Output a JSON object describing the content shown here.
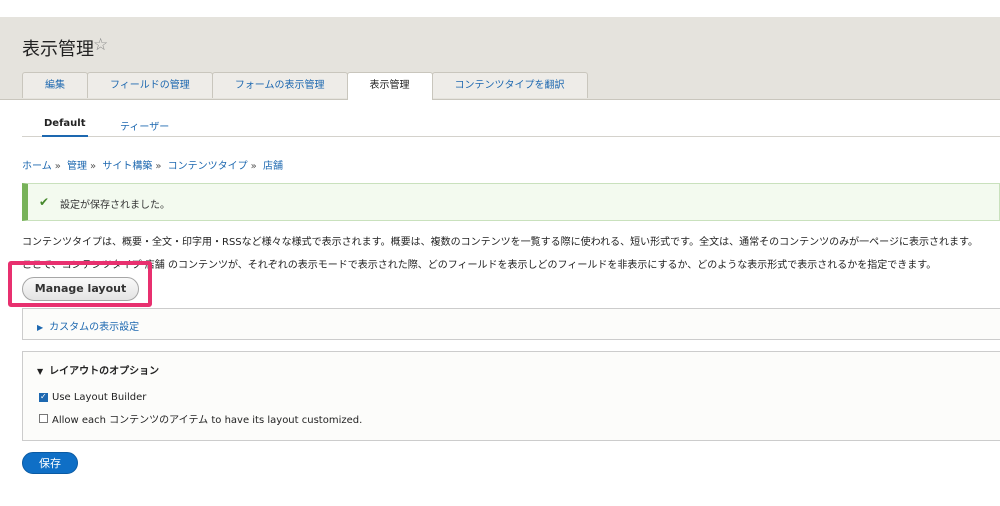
{
  "header": {
    "title": "表示管理",
    "star_icon": "☆"
  },
  "tabs": [
    {
      "label": "編集"
    },
    {
      "label": "フィールドの管理"
    },
    {
      "label": "フォームの表示管理"
    },
    {
      "label": "表示管理"
    },
    {
      "label": "コンテンツタイプを翻訳"
    }
  ],
  "subtabs": [
    {
      "label": "Default"
    },
    {
      "label": "ティーザー"
    }
  ],
  "breadcrumb": [
    {
      "label": "ホーム"
    },
    {
      "label": "管理"
    },
    {
      "label": "サイト構築"
    },
    {
      "label": "コンテンツタイプ"
    },
    {
      "label": "店舗"
    }
  ],
  "breadcrumb_sep": "»",
  "status": {
    "check": "✔",
    "message": "設定が保存されました。"
  },
  "description": {
    "line1": "コンテンツタイプは、概要・全文・印字用・RSSなど様々な様式で表示されます。概要は、複数のコンテンツを一覧する際に使われる、短い形式です。全文は、通常そのコンテンツのみが一ページに表示されます。",
    "line2": "ここで、コンテンツタイプ 店舗 のコンテンツが、それぞれの表示モードで表示された際、どのフィールドを表示しどのフィールドを非表示にするか、どのような表示形式で表示されるかを指定できます。"
  },
  "manage_layout_label": "Manage layout",
  "custom_display": {
    "triangle": "▶",
    "label": "カスタムの表示設定"
  },
  "layout_options": {
    "triangle": "▼",
    "label": "レイアウトのオプション",
    "use_layout_builder": {
      "label": "Use Layout Builder",
      "checked": true
    },
    "allow_custom": {
      "label": "Allow each コンテンツのアイテム to have its layout customized.",
      "checked": false
    }
  },
  "save_label": "保存",
  "colors": {
    "accent": "#1d68b0",
    "highlight": "#e8306f",
    "success": "#77b259",
    "primary_button": "#0f6fc6"
  }
}
